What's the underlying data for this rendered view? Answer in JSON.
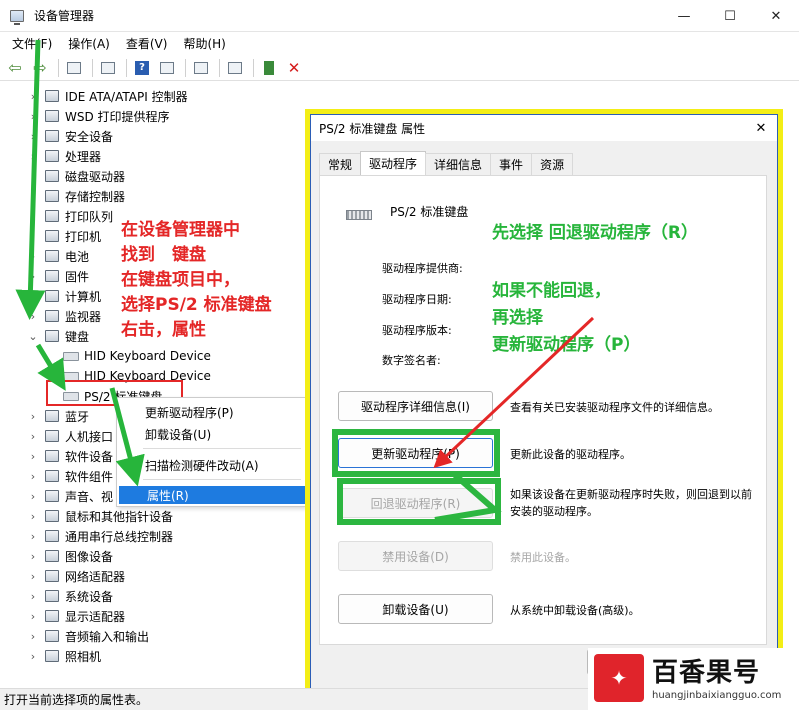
{
  "window": {
    "title": "设备管理器",
    "controls": {
      "minimize": "—",
      "maximize": "☐",
      "close": "✕"
    }
  },
  "menu": [
    "文件(F)",
    "操作(A)",
    "查看(V)",
    "帮助(H)"
  ],
  "toolbar": {
    "back": "⇦",
    "forward": "⇨",
    "help": "?",
    "delete": "✕"
  },
  "tree": {
    "categories": [
      "IDE ATA/ATAPI 控制器",
      "WSD 打印提供程序",
      "安全设备",
      "处理器",
      "磁盘驱动器",
      "存储控制器",
      "打印队列",
      "打印机",
      "电池",
      "固件",
      "计算机",
      "监视器",
      "键盘"
    ],
    "keyboard_children": [
      "HID Keyboard Device",
      "HID Keyboard Device",
      "PS/2 标准键盘"
    ],
    "after": [
      "蓝牙",
      "人机接口",
      "软件设备",
      "软件组件",
      "声音、视",
      "鼠标和其他指针设备",
      "通用串行总线控制器",
      "图像设备",
      "网络适配器",
      "系统设备",
      "显示适配器",
      "音频输入和输出",
      "照相机"
    ]
  },
  "context_menu": {
    "items": [
      "更新驱动程序(P)",
      "卸载设备(U)",
      "扫描检测硬件改动(A)",
      "属性(R)"
    ]
  },
  "annotation_left": [
    "在设备管理器中",
    "找到　键盘",
    "在键盘项目中，",
    "选择PS/2 标准键盘",
    "右击，属性"
  ],
  "dialog": {
    "title": "PS/2 标准键盘 属性",
    "close": "✕",
    "tabs": [
      "常规",
      "驱动程序",
      "详细信息",
      "事件",
      "资源"
    ],
    "device_name": "PS/2 标准键盘",
    "info_labels": [
      "驱动程序提供商:",
      "驱动程序日期:",
      "驱动程序版本:",
      "数字签名者:"
    ],
    "buttons": [
      {
        "label": "驱动程序详细信息(I)",
        "desc": "查看有关已安装驱动程序文件的详细信息。"
      },
      {
        "label": "更新驱动程序(P)",
        "desc": "更新此设备的驱动程序。"
      },
      {
        "label": "回退驱动程序(R)",
        "desc": "如果该设备在更新驱动程序时失败，则回退到以前安装的驱动程序。"
      },
      {
        "label": "禁用设备(D)",
        "desc": "禁用此设备。"
      },
      {
        "label": "卸载设备(U)",
        "desc": "从系统中卸载设备(高级)。"
      }
    ]
  },
  "annotation_right": {
    "line1": "先选择 回退驱动程序（R）",
    "line2": "如果不能回退，",
    "line3": "再选择",
    "line4": "更新驱动程序（P）"
  },
  "statusbar": "打开当前选择项的属性表。",
  "watermark": {
    "name": "百香果号",
    "url": "huangjinbaixiangguo.com",
    "logo": "✦"
  },
  "colors": {
    "annotation_red": "#e42727",
    "annotation_green": "#27b53b",
    "highlight_frame": "#f3ee16",
    "menu_highlight": "#1e7be0"
  }
}
